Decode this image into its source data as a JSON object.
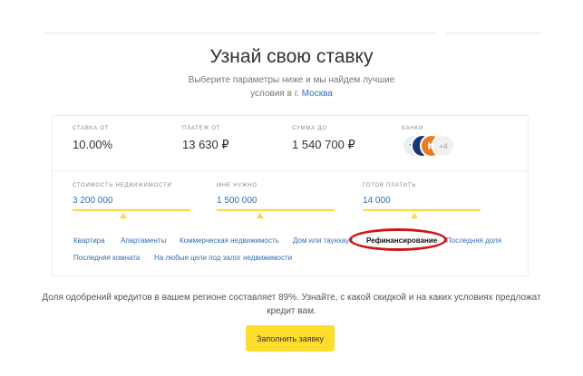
{
  "hero": {
    "title": "Узнай свою ставку",
    "subtitle_line1": "Выберите параметры ниже и мы найдем лучшие",
    "subtitle_prefix": "условия в г.",
    "city": "Москва"
  },
  "stats": [
    {
      "label": "Ставка от",
      "value": "10.00%"
    },
    {
      "label": "Платеж от",
      "value": "13 630 ₽"
    },
    {
      "label": "Сумма до",
      "value": "1 540 700 ₽"
    }
  ],
  "banks": {
    "label": "Банки",
    "icons": [
      "bank-emblem-icon",
      "bank-blue-logo-icon",
      "bank-orange-logo-icon"
    ],
    "more": "+4"
  },
  "fields": [
    {
      "label": "Стоимость недвижимости",
      "value": "3 200 000"
    },
    {
      "label": "Мне нужно",
      "value": "1 500 000"
    },
    {
      "label": "Готов платить",
      "value": "14 000"
    }
  ],
  "categories": [
    "Квартира",
    "Апартаменты",
    "Коммерческая недвижимость",
    "Дом или таунхаус",
    "Рефинансирование",
    "Последняя доля",
    "Последняя комната",
    "На любые цели под залог недвижимости"
  ],
  "selected_category": "Рефинансирование",
  "footer_note": "Доля одобрений кредитов в вашем регионе составляет 89%. Узнайте, с какой скидкой и на каких условиях предложат кредит вам.",
  "submit_label": "Заполнить заявку",
  "colors": {
    "accent_yellow": "#ffdd2d",
    "link_blue": "#336fb7",
    "annotation_red": "#d01515"
  }
}
